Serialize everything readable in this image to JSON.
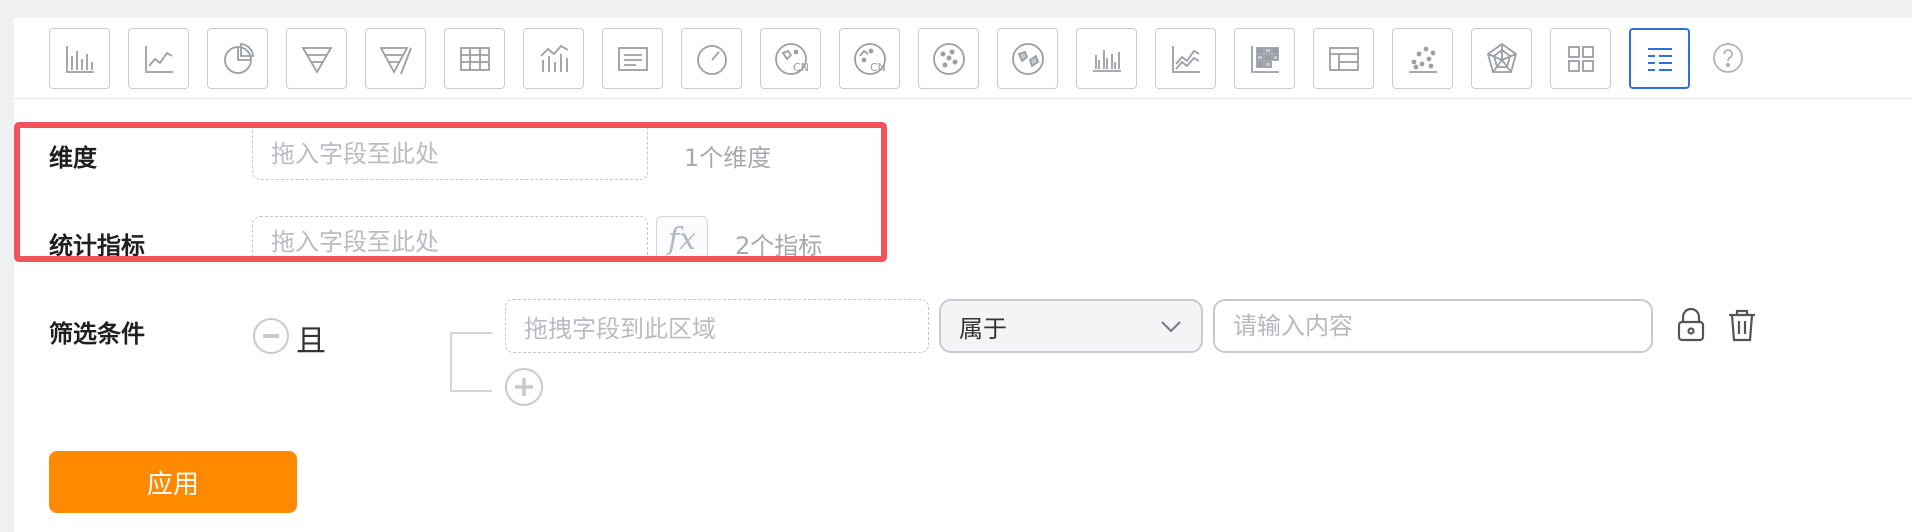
{
  "toolbar": {
    "chart_types": [
      {
        "icon": "bar-chart-icon"
      },
      {
        "icon": "line-chart-icon"
      },
      {
        "icon": "pie-chart-icon"
      },
      {
        "icon": "funnel-icon"
      },
      {
        "icon": "funnel-compare-icon"
      },
      {
        "icon": "table-icon"
      },
      {
        "icon": "bar-line-combo-icon"
      },
      {
        "icon": "text-card-icon"
      },
      {
        "icon": "gauge-icon"
      },
      {
        "icon": "china-map-icon",
        "badge": "CN"
      },
      {
        "icon": "china-bubble-map-icon",
        "badge": "CN"
      },
      {
        "icon": "world-bubble-map-icon"
      },
      {
        "icon": "world-map-icon"
      },
      {
        "icon": "dual-axis-bar-icon"
      },
      {
        "icon": "area-line-icon"
      },
      {
        "icon": "heatmap-table-icon"
      },
      {
        "icon": "pivot-table-icon"
      },
      {
        "icon": "scatter-icon"
      },
      {
        "icon": "radar-icon"
      },
      {
        "icon": "grid-layout-icon"
      },
      {
        "icon": "detail-list-icon",
        "active": true
      }
    ],
    "help_icon": "help-icon",
    "active_color": "#2f6fe0"
  },
  "dimension": {
    "label": "维度",
    "placeholder": "拖入字段至此处",
    "count": "1个维度"
  },
  "metric": {
    "label": "统计指标",
    "placeholder": "拖入字段至此处",
    "fx_label": "fx",
    "count": "2个指标"
  },
  "filter": {
    "label": "筛选条件",
    "logic": "且",
    "field_placeholder": "拖拽字段到此区域",
    "operator": "属于",
    "value_placeholder": "请输入内容"
  },
  "apply_label": "应用",
  "colors": {
    "highlight": "#f0545a",
    "apply": "#ff8a00"
  }
}
